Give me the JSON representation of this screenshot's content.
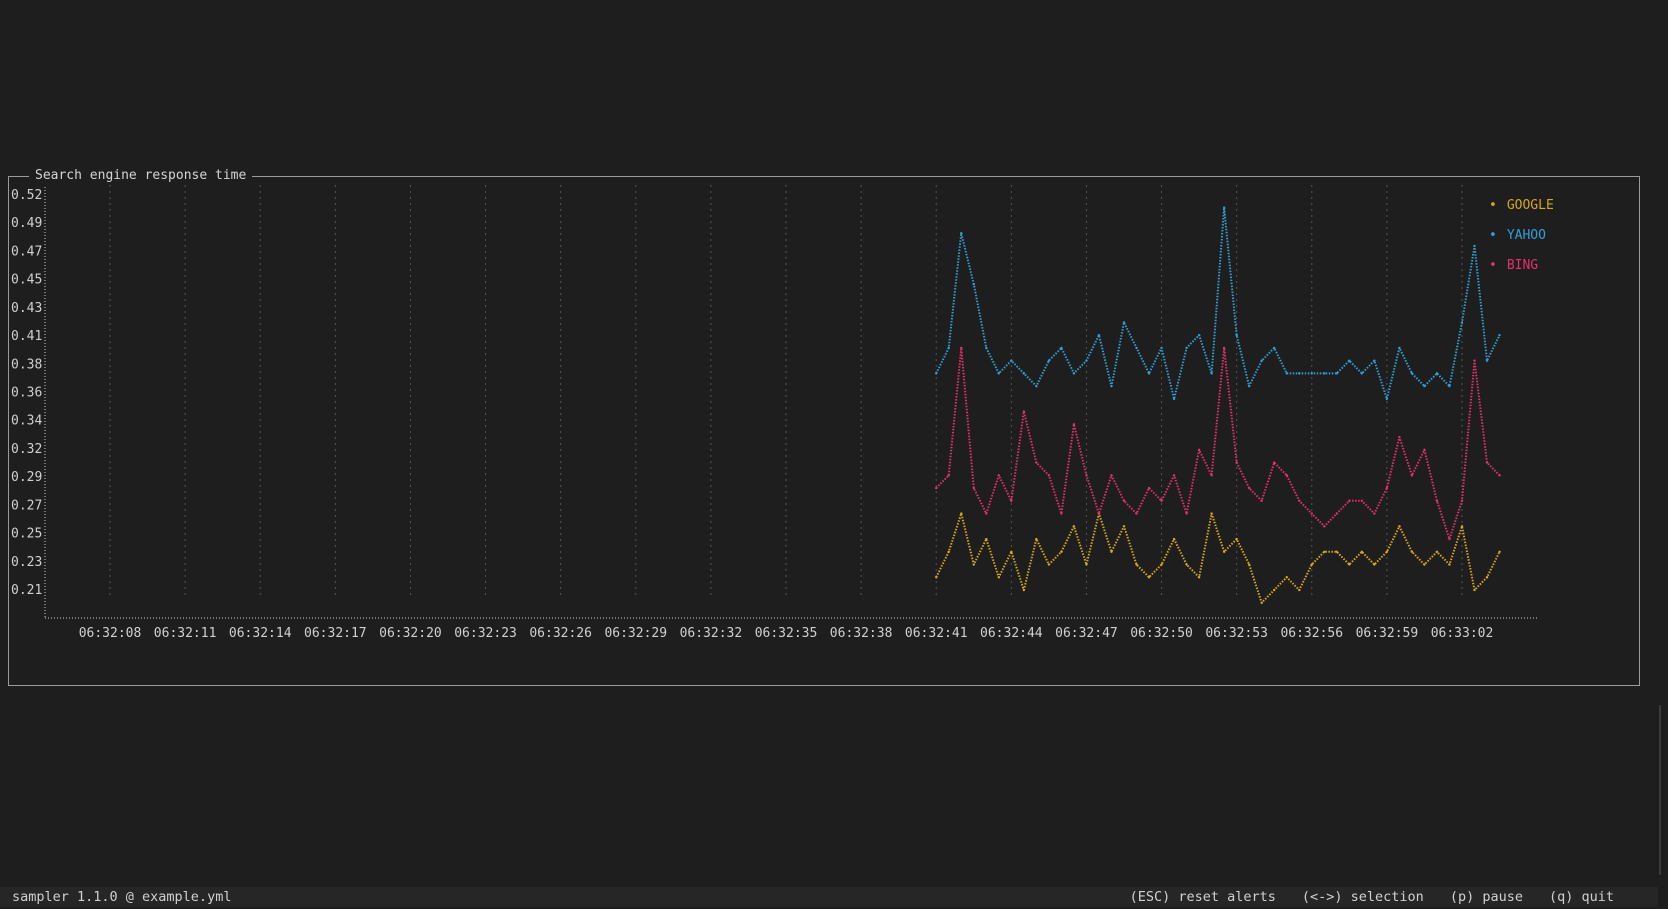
{
  "panel": {
    "title": "Search engine response time"
  },
  "chart_data": {
    "type": "line",
    "title": "Search engine response time",
    "y_ticks": [
      "0.52",
      "0.49",
      "0.47",
      "0.45",
      "0.43",
      "0.41",
      "0.38",
      "0.36",
      "0.34",
      "0.32",
      "0.29",
      "0.27",
      "0.25",
      "0.23",
      "0.21"
    ],
    "ylim": [
      0.21,
      0.52
    ],
    "x_ticks": [
      "06:32:08",
      "06:32:11",
      "06:32:14",
      "06:32:17",
      "06:32:20",
      "06:32:23",
      "06:32:26",
      "06:32:29",
      "06:32:32",
      "06:32:35",
      "06:32:38",
      "06:32:41",
      "06:32:44",
      "06:32:47",
      "06:32:50",
      "06:32:53",
      "06:32:56",
      "06:32:59",
      "06:33:02"
    ],
    "grid": "vertical dotted",
    "legend_position": "top-right",
    "series": [
      {
        "name": "GOOGLE",
        "color": "#d9a520",
        "points": [
          [
            "06:32:41.0",
            0.22
          ],
          [
            "06:32:41.5",
            0.24
          ],
          [
            "06:32:42.0",
            0.27
          ],
          [
            "06:32:42.5",
            0.23
          ],
          [
            "06:32:43.0",
            0.25
          ],
          [
            "06:32:43.5",
            0.22
          ],
          [
            "06:32:44.0",
            0.24
          ],
          [
            "06:32:44.5",
            0.21
          ],
          [
            "06:32:45.0",
            0.25
          ],
          [
            "06:32:45.5",
            0.23
          ],
          [
            "06:32:46.0",
            0.24
          ],
          [
            "06:32:46.5",
            0.26
          ],
          [
            "06:32:47.0",
            0.23
          ],
          [
            "06:32:47.5",
            0.27
          ],
          [
            "06:32:48.0",
            0.24
          ],
          [
            "06:32:48.5",
            0.26
          ],
          [
            "06:32:49.0",
            0.23
          ],
          [
            "06:32:49.5",
            0.22
          ],
          [
            "06:32:50.0",
            0.23
          ],
          [
            "06:32:50.5",
            0.25
          ],
          [
            "06:32:51.0",
            0.23
          ],
          [
            "06:32:51.5",
            0.22
          ],
          [
            "06:32:52.0",
            0.27
          ],
          [
            "06:32:52.5",
            0.24
          ],
          [
            "06:32:53.0",
            0.25
          ],
          [
            "06:32:53.5",
            0.23
          ],
          [
            "06:32:54.0",
            0.2
          ],
          [
            "06:32:54.5",
            0.21
          ],
          [
            "06:32:55.0",
            0.22
          ],
          [
            "06:32:55.5",
            0.21
          ],
          [
            "06:32:56.0",
            0.23
          ],
          [
            "06:32:56.5",
            0.24
          ],
          [
            "06:32:57.0",
            0.24
          ],
          [
            "06:32:57.5",
            0.23
          ],
          [
            "06:32:58.0",
            0.24
          ],
          [
            "06:32:58.5",
            0.23
          ],
          [
            "06:32:59.0",
            0.24
          ],
          [
            "06:32:59.5",
            0.26
          ],
          [
            "06:33:00.0",
            0.24
          ],
          [
            "06:33:00.5",
            0.23
          ],
          [
            "06:33:01.0",
            0.24
          ],
          [
            "06:33:01.5",
            0.23
          ],
          [
            "06:33:02.0",
            0.26
          ],
          [
            "06:33:02.5",
            0.21
          ],
          [
            "06:33:03.0",
            0.22
          ],
          [
            "06:33:03.5",
            0.24
          ]
        ]
      },
      {
        "name": "YAHOO",
        "color": "#2f9fd6",
        "points": [
          [
            "06:32:41.0",
            0.38
          ],
          [
            "06:32:41.5",
            0.4
          ],
          [
            "06:32:42.0",
            0.49
          ],
          [
            "06:32:42.5",
            0.45
          ],
          [
            "06:32:43.0",
            0.4
          ],
          [
            "06:32:43.5",
            0.38
          ],
          [
            "06:32:44.0",
            0.39
          ],
          [
            "06:32:44.5",
            0.38
          ],
          [
            "06:32:45.0",
            0.37
          ],
          [
            "06:32:45.5",
            0.39
          ],
          [
            "06:32:46.0",
            0.4
          ],
          [
            "06:32:46.5",
            0.38
          ],
          [
            "06:32:47.0",
            0.39
          ],
          [
            "06:32:47.5",
            0.41
          ],
          [
            "06:32:48.0",
            0.37
          ],
          [
            "06:32:48.5",
            0.42
          ],
          [
            "06:32:49.0",
            0.4
          ],
          [
            "06:32:49.5",
            0.38
          ],
          [
            "06:32:50.0",
            0.4
          ],
          [
            "06:32:50.5",
            0.36
          ],
          [
            "06:32:51.0",
            0.4
          ],
          [
            "06:32:51.5",
            0.41
          ],
          [
            "06:32:52.0",
            0.38
          ],
          [
            "06:32:52.5",
            0.51
          ],
          [
            "06:32:53.0",
            0.41
          ],
          [
            "06:32:53.5",
            0.37
          ],
          [
            "06:32:54.0",
            0.39
          ],
          [
            "06:32:54.5",
            0.4
          ],
          [
            "06:32:55.0",
            0.38
          ],
          [
            "06:32:55.5",
            0.38
          ],
          [
            "06:32:56.0",
            0.38
          ],
          [
            "06:32:56.5",
            0.38
          ],
          [
            "06:32:57.0",
            0.38
          ],
          [
            "06:32:57.5",
            0.39
          ],
          [
            "06:32:58.0",
            0.38
          ],
          [
            "06:32:58.5",
            0.39
          ],
          [
            "06:32:59.0",
            0.36
          ],
          [
            "06:32:59.5",
            0.4
          ],
          [
            "06:33:00.0",
            0.38
          ],
          [
            "06:33:00.5",
            0.37
          ],
          [
            "06:33:01.0",
            0.38
          ],
          [
            "06:33:01.5",
            0.37
          ],
          [
            "06:33:02.0",
            0.42
          ],
          [
            "06:33:02.5",
            0.48
          ],
          [
            "06:33:03.0",
            0.39
          ],
          [
            "06:33:03.5",
            0.41
          ]
        ]
      },
      {
        "name": "BING",
        "color": "#e3306e",
        "points": [
          [
            "06:32:41.0",
            0.29
          ],
          [
            "06:32:41.5",
            0.3
          ],
          [
            "06:32:42.0",
            0.4
          ],
          [
            "06:32:42.5",
            0.29
          ],
          [
            "06:32:43.0",
            0.27
          ],
          [
            "06:32:43.5",
            0.3
          ],
          [
            "06:32:44.0",
            0.28
          ],
          [
            "06:32:44.5",
            0.35
          ],
          [
            "06:32:45.0",
            0.31
          ],
          [
            "06:32:45.5",
            0.3
          ],
          [
            "06:32:46.0",
            0.27
          ],
          [
            "06:32:46.5",
            0.34
          ],
          [
            "06:32:47.0",
            0.3
          ],
          [
            "06:32:47.5",
            0.27
          ],
          [
            "06:32:48.0",
            0.3
          ],
          [
            "06:32:48.5",
            0.28
          ],
          [
            "06:32:49.0",
            0.27
          ],
          [
            "06:32:49.5",
            0.29
          ],
          [
            "06:32:50.0",
            0.28
          ],
          [
            "06:32:50.5",
            0.3
          ],
          [
            "06:32:51.0",
            0.27
          ],
          [
            "06:32:51.5",
            0.32
          ],
          [
            "06:32:52.0",
            0.3
          ],
          [
            "06:32:52.5",
            0.4
          ],
          [
            "06:32:53.0",
            0.31
          ],
          [
            "06:32:53.5",
            0.29
          ],
          [
            "06:32:54.0",
            0.28
          ],
          [
            "06:32:54.5",
            0.31
          ],
          [
            "06:32:55.0",
            0.3
          ],
          [
            "06:32:55.5",
            0.28
          ],
          [
            "06:32:56.0",
            0.27
          ],
          [
            "06:32:56.5",
            0.26
          ],
          [
            "06:32:57.0",
            0.27
          ],
          [
            "06:32:57.5",
            0.28
          ],
          [
            "06:32:58.0",
            0.28
          ],
          [
            "06:32:58.5",
            0.27
          ],
          [
            "06:32:59.0",
            0.29
          ],
          [
            "06:32:59.5",
            0.33
          ],
          [
            "06:33:00.0",
            0.3
          ],
          [
            "06:33:00.5",
            0.32
          ],
          [
            "06:33:01.0",
            0.28
          ],
          [
            "06:33:01.5",
            0.25
          ],
          [
            "06:33:02.0",
            0.28
          ],
          [
            "06:33:02.5",
            0.39
          ],
          [
            "06:33:03.0",
            0.31
          ],
          [
            "06:33:03.5",
            0.3
          ]
        ]
      }
    ]
  },
  "statusbar": {
    "app_info": "sampler 1.1.0 @ example.yml",
    "hotkeys": [
      "(ESC) reset alerts",
      "(<->) selection",
      "(p) pause",
      "(q) quit"
    ]
  }
}
